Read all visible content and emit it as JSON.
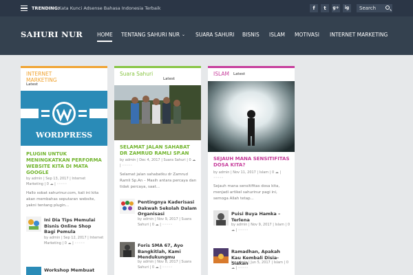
{
  "topbar": {
    "trending_label": "TRENDING:",
    "trending_text": "Kata Kunci Adsense Bahasa Indonesia Terbaik",
    "social": [
      "f",
      "t",
      "g+",
      "ig"
    ],
    "search_placeholder": "Search"
  },
  "logo": "SAHURI NUR",
  "nav": [
    "HOME",
    "TENTANG SAHURI NUR",
    "SUARA SAHURI",
    "BISNIS",
    "ISLAM",
    "MOTIVASI",
    "INTERNET MARKETING"
  ],
  "colors": {
    "topbar": "#2b3646",
    "header": "#34414f",
    "orange": "#f0a22e",
    "green": "#86c440",
    "pink": "#c63b9a"
  },
  "cards": [
    {
      "section": "INTERNET MARKETING",
      "latest": "Latest",
      "featured_title": "PLUGIN UNTUK MENINGKATKAN PERFORMA WEBSITE KITA DI MATA GOOGLE",
      "featured_meta": "by admin | Sep 13, 2017 | Internet Marketing | 0 ☁ | ◦◦◦◦◦",
      "excerpt": "Hallo sobat sahurinur.com, kali ini kita akan membahas seputaran website, yakni tentang plugin...",
      "image_label": "WORDPRESS",
      "items": [
        {
          "title": "Ini Dia Tips Memulai Bisnis Online Shop Bagi Pemula",
          "meta": "by admin | Sep 12, 2017 | Internet Marketing | 0 ☁ | ◦◦◦◦◦"
        },
        {
          "title": "Workshop Membuat",
          "meta": ""
        }
      ]
    },
    {
      "section": "Suara Sahuri",
      "latest": "Latest",
      "featured_title": "SELAMAT JALAN SAHABAT DR ZAMRUD RAMLI SP.AN",
      "featured_meta": "by admin | Dec 4, 2017 | Suara Sahuri | 0 ☁ | ◦◦◦◦◦",
      "excerpt": "Selamat jalan sahabatku dr Zamrud Ramli Sp.An – Masih antara percaya dan tidak percaya, saat...",
      "items": [
        {
          "title": "Pentingnya Kaderisasi Dakwah Sekolah Dalam Organisasi",
          "meta": "by admin | Nov 9, 2017 | Suara Sahuri | 0 ☁ | ◦◦◦◦◦"
        },
        {
          "title": "Foris SMA 67, Ayo Bangkitlah, Kami Mendukungmu",
          "meta": "by admin | Nov 8, 2017 | Suara Sahuri | 0 ☁ | ◦◦◦◦◦"
        }
      ]
    },
    {
      "section": "ISLAM",
      "latest": "Latest",
      "featured_title": "SEJAUH MANA SENSITIFITAS DOSA KITA?",
      "featured_meta": "by admin | Nov 11, 2017 | Islam | 0 ☁ | ◦◦◦◦◦",
      "excerpt": "Sejauh mana sensitifitas dosa kita, menjadi artikel sahurinur pagi ini, semoga Allah tetap...",
      "items": [
        {
          "title": "Puisi Buya Hamka – Terlena",
          "meta": "by admin | Nov 9, 2017 | Islam | 0 ☁ | ◦◦◦◦◦"
        },
        {
          "title": "Ramadhan, Apakah Kau Kembali Disia-Siakan",
          "meta": "by admin | Jun 5, 2017 | Islam | 0 ☁ | ◦◦◦◦◦"
        }
      ]
    }
  ]
}
